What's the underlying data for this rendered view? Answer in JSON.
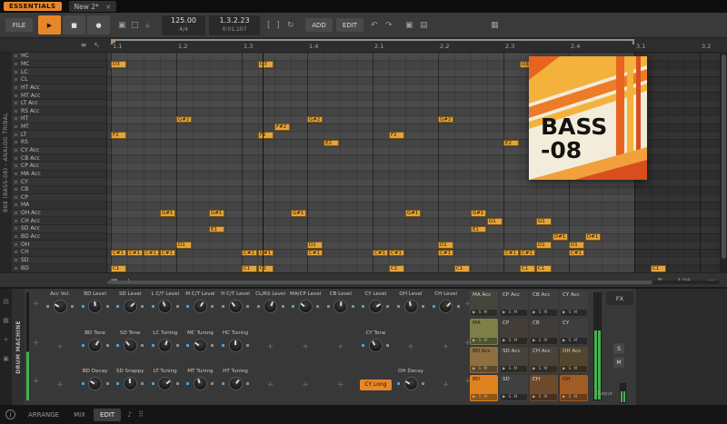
{
  "titlebar": {
    "badge": "ESSENTIALS",
    "tab": "New 2*",
    "close": "×"
  },
  "toolbar": {
    "file": "FILE",
    "tempo": "125.00",
    "meter": "4/4",
    "position": "1.3.2.23",
    "time": "0:01.107",
    "add": "ADD",
    "edit": "EDIT"
  },
  "icons": {
    "play": "▶",
    "stop": "■",
    "record": "●",
    "toggle_a": "▣",
    "toggle_b": "□",
    "metronome": "▵",
    "punch_in": "[",
    "punch_out": "]",
    "loop": "↻",
    "undo": "↶",
    "redo": "↷",
    "copy": "▣",
    "paste": "▤",
    "grid": "▦",
    "menu": "≡",
    "pointer": "↖",
    "plus": "+",
    "pad_play": "▶",
    "info": "i",
    "note": "♪",
    "handle": "⠿",
    "dots": "⋯",
    "updown": "⇅",
    "footer_grid": "▦",
    "footer_plus": "+"
  },
  "ruler": {
    "ticks": [
      "1.1",
      "1.2",
      "1.3",
      "1.4",
      "2.1",
      "2.2",
      "2.3",
      "2.4",
      "3.1",
      "3.2"
    ]
  },
  "clip": {
    "track_label": "B08 (BASS-08) - ANALOG TRIBAL",
    "zoom": "1/16"
  },
  "lanes": [
    "HC",
    "MC",
    "LC",
    "CL",
    "HT Acc",
    "MT Acc",
    "LT Acc",
    "RS Acc",
    "HT",
    "MT",
    "LT",
    "RS",
    "CY Acc",
    "CB Acc",
    "CP Acc",
    "MA Acc",
    "CY",
    "CB",
    "CP",
    "MA",
    "OH Acc",
    "CH Acc",
    "SD Acc",
    "BD Acc",
    "OH",
    "CH",
    "SD",
    "BD"
  ],
  "notes": [
    {
      "lane": 1,
      "step": 0,
      "label": "D3"
    },
    {
      "lane": 1,
      "step": 9,
      "label": "D3"
    },
    {
      "lane": 1,
      "step": 25,
      "label": "D3"
    },
    {
      "lane": 8,
      "step": 4,
      "label": "G#2"
    },
    {
      "lane": 8,
      "step": 12,
      "label": "G#2"
    },
    {
      "lane": 8,
      "step": 20,
      "label": "G#2"
    },
    {
      "lane": 9,
      "step": 10,
      "label": "F#2"
    },
    {
      "lane": 10,
      "step": 0,
      "label": "F2"
    },
    {
      "lane": 10,
      "step": 9,
      "label": "F2"
    },
    {
      "lane": 10,
      "step": 17,
      "label": "F2"
    },
    {
      "lane": 11,
      "step": 13,
      "label": "E2"
    },
    {
      "lane": 11,
      "step": 24,
      "label": "E2"
    },
    {
      "lane": 20,
      "step": 3,
      "label": "G#1"
    },
    {
      "lane": 20,
      "step": 6,
      "label": "G#1"
    },
    {
      "lane": 20,
      "step": 11,
      "label": "G#1"
    },
    {
      "lane": 20,
      "step": 18,
      "label": "G#1"
    },
    {
      "lane": 20,
      "step": 22,
      "label": "G#1"
    },
    {
      "lane": 21,
      "step": 23,
      "label": "G1"
    },
    {
      "lane": 21,
      "step": 26,
      "label": "G1"
    },
    {
      "lane": 22,
      "step": 6,
      "label": "E1"
    },
    {
      "lane": 22,
      "step": 22,
      "label": "E1"
    },
    {
      "lane": 23,
      "step": 27,
      "label": "D#1"
    },
    {
      "lane": 23,
      "step": 29,
      "label": "D#1"
    },
    {
      "lane": 24,
      "step": 4,
      "label": "D1"
    },
    {
      "lane": 24,
      "step": 12,
      "label": "D1"
    },
    {
      "lane": 24,
      "step": 20,
      "label": "D1"
    },
    {
      "lane": 24,
      "step": 26,
      "label": "D1"
    },
    {
      "lane": 24,
      "step": 28,
      "label": "D1"
    },
    {
      "lane": 25,
      "step": 0,
      "label": "C#1"
    },
    {
      "lane": 25,
      "step": 1,
      "label": "C#1"
    },
    {
      "lane": 25,
      "step": 2,
      "label": "C#1"
    },
    {
      "lane": 25,
      "step": 3,
      "label": "C#1"
    },
    {
      "lane": 25,
      "step": 8,
      "label": "C#1"
    },
    {
      "lane": 25,
      "step": 9,
      "label": "C#1"
    },
    {
      "lane": 25,
      "step": 12,
      "label": "C#1"
    },
    {
      "lane": 25,
      "step": 16,
      "label": "C#1"
    },
    {
      "lane": 25,
      "step": 17,
      "label": "C#1"
    },
    {
      "lane": 25,
      "step": 20,
      "label": "C#1"
    },
    {
      "lane": 25,
      "step": 24,
      "label": "C#1"
    },
    {
      "lane": 25,
      "step": 25,
      "label": "C#1"
    },
    {
      "lane": 25,
      "step": 28,
      "label": "C#1"
    },
    {
      "lane": 27,
      "step": 0,
      "label": "C1"
    },
    {
      "lane": 27,
      "step": 8,
      "label": "C1"
    },
    {
      "lane": 27,
      "step": 9,
      "label": "C1"
    },
    {
      "lane": 27,
      "step": 17,
      "label": "C1"
    },
    {
      "lane": 27,
      "step": 21,
      "label": "C1"
    },
    {
      "lane": 27,
      "step": 25,
      "label": "C1"
    },
    {
      "lane": 27,
      "step": 26,
      "label": "C1"
    },
    {
      "lane": 27,
      "step": 33,
      "label": "C1"
    }
  ],
  "artwork": {
    "line1": "BASS",
    "line2": "-08"
  },
  "device": {
    "title": "DRUM MACHINE",
    "knobs": [
      {
        "row": 0,
        "col": 0,
        "label": "Acc Vol."
      },
      {
        "row": 0,
        "col": 1,
        "label": "BD Level"
      },
      {
        "row": 0,
        "col": 2,
        "label": "SD Level"
      },
      {
        "row": 0,
        "col": 3,
        "label": "L C/T Level"
      },
      {
        "row": 0,
        "col": 4,
        "label": "M C/T Level"
      },
      {
        "row": 0,
        "col": 5,
        "label": "H C/T Level"
      },
      {
        "row": 0,
        "col": 6,
        "label": "CL/RS Level"
      },
      {
        "row": 0,
        "col": 7,
        "label": "MA/CP Level"
      },
      {
        "row": 0,
        "col": 8,
        "label": "CB Level"
      },
      {
        "row": 0,
        "col": 9,
        "label": "CY Level"
      },
      {
        "row": 0,
        "col": 10,
        "label": "OH Level"
      },
      {
        "row": 0,
        "col": 11,
        "label": "CH Level"
      },
      {
        "row": 1,
        "col": 1,
        "label": "BD Tone"
      },
      {
        "row": 1,
        "col": 2,
        "label": "SD Tone"
      },
      {
        "row": 1,
        "col": 3,
        "label": "LC Tuning"
      },
      {
        "row": 1,
        "col": 4,
        "label": "MC Tuning"
      },
      {
        "row": 1,
        "col": 5,
        "label": "HC Tuning"
      },
      {
        "row": 1,
        "col": 9,
        "label": "CY Tone"
      },
      {
        "row": 2,
        "col": 1,
        "label": "BD Decay"
      },
      {
        "row": 2,
        "col": 2,
        "label": "SD Snappy"
      },
      {
        "row": 2,
        "col": 3,
        "label": "LT Tuning"
      },
      {
        "row": 2,
        "col": 4,
        "label": "MT Tuning"
      },
      {
        "row": 2,
        "col": 5,
        "label": "HT Tuning"
      },
      {
        "row": 2,
        "col": 10,
        "label": "OH Decay"
      }
    ],
    "button": {
      "row": 2,
      "col": 9,
      "label": "CY Long"
    },
    "pads": [
      {
        "label": "MA Acc",
        "color": "#45453c",
        "text": "#cfcfcf"
      },
      {
        "label": "CP Acc",
        "color": "#3e3e3e",
        "text": "#cfcfcf"
      },
      {
        "label": "CB Acc",
        "color": "#3e3e3e",
        "text": "#cfcfcf"
      },
      {
        "label": "CY Acc",
        "color": "#3e3e3e",
        "text": "#cfcfcf"
      },
      {
        "label": "MA",
        "color": "#7d7f48",
        "text": "#22230f"
      },
      {
        "label": "CP",
        "color": "#443e38",
        "text": "#cfcfcf"
      },
      {
        "label": "CB",
        "color": "#403c38",
        "text": "#cfcfcf"
      },
      {
        "label": "CY",
        "color": "#3e3e3e",
        "text": "#cfcfcf"
      },
      {
        "label": "BD Acc",
        "color": "#8f6e40",
        "text": "#241a08"
      },
      {
        "label": "SD Acc",
        "color": "#45413b",
        "text": "#cfcfcf"
      },
      {
        "label": "CH Acc",
        "color": "#4a4238",
        "text": "#cfcfcf"
      },
      {
        "label": "OH Acc",
        "color": "#53462f",
        "text": "#cfcfcf"
      },
      {
        "label": "BD",
        "color": "#e0811f",
        "text": "#2a1800"
      },
      {
        "label": "SD",
        "color": "#404040",
        "text": "#cfcfcf"
      },
      {
        "label": "CH",
        "color": "#6f4b2b",
        "text": "#f0e3d4"
      },
      {
        "label": "OH",
        "color": "#a35c26",
        "text": "#2a1504"
      }
    ],
    "fx": "FX",
    "solo": "S",
    "mute": "M",
    "output": "Output"
  },
  "statusbar": {
    "info": "i",
    "tabs": [
      "ARRANGE",
      "MIX",
      "EDIT"
    ],
    "active_tab": "EDIT"
  },
  "colors": {
    "accent": "#e8872a",
    "note_fill": "#e2a43e"
  }
}
